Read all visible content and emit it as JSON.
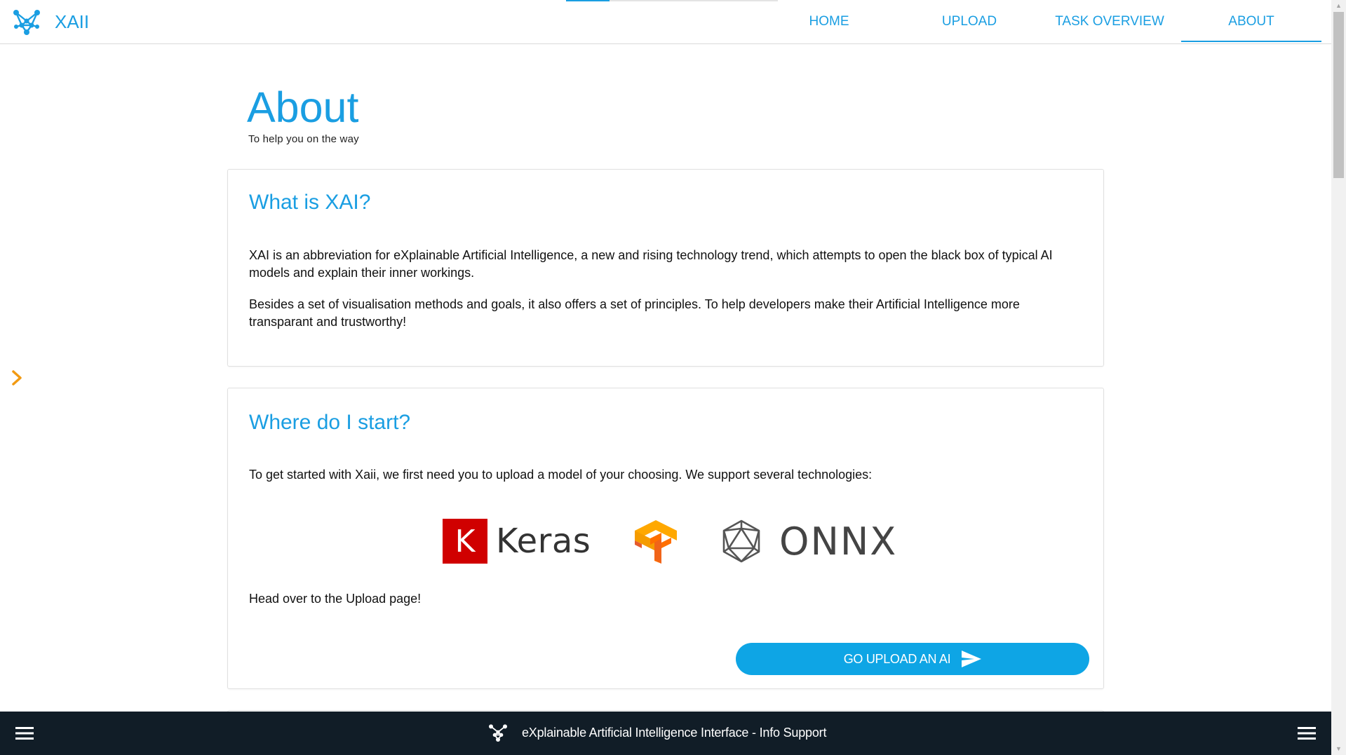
{
  "app": {
    "name": "XAII",
    "logo_icon": "network-molecule-icon",
    "accent_color": "#1a9ee2"
  },
  "nav": {
    "items": [
      {
        "label": "HOME",
        "active": false
      },
      {
        "label": "UPLOAD",
        "active": false
      },
      {
        "label": "TASK OVERVIEW",
        "active": false
      },
      {
        "label": "ABOUT",
        "active": true
      }
    ]
  },
  "page": {
    "title": "About",
    "subtitle": "To help you on the way"
  },
  "cards": {
    "what": {
      "title": "What is XAI?",
      "paragraphs": [
        "XAI is an abbreviation for eXplainable Artificial Intelligence, a new and rising technology trend, which attempts to open the black box of typical AI models and explain their inner workings.",
        "Besides a set of visualisation methods and goals, it also offers a set of principles. To help developers make their Artificial Intelligence more transparant and trustworthy!"
      ]
    },
    "start": {
      "title": "Where do I start?",
      "intro": "To get started with Xaii, we first need you to upload a model of your choosing. We support several technologies:",
      "technologies": {
        "keras_mark": "K",
        "keras_name": "Keras",
        "tensorflow_icon": "tensorflow-logo-icon",
        "onnx_name": "ONNX"
      },
      "cta_text": "Head over to the Upload page!",
      "button_label": "GO UPLOAD AN AI",
      "button_icon": "send-arrow-icon"
    }
  },
  "footer": {
    "text": "eXplainable Artificial Intelligence Interface - Info Support",
    "menu_icon": "hamburger-menu-icon",
    "background": "#111d27"
  }
}
